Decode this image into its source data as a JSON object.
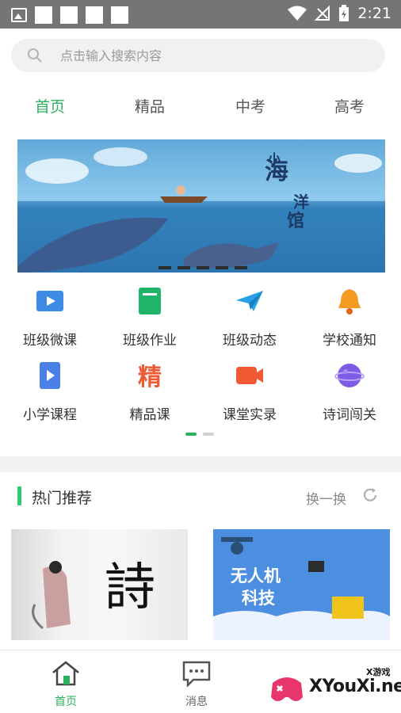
{
  "status_bar": {
    "time": "2:21"
  },
  "search": {
    "placeholder": "点击输入搜索内容"
  },
  "tabs": [
    {
      "label": "首页",
      "active": true
    },
    {
      "label": "精品",
      "active": false
    },
    {
      "label": "中考",
      "active": false
    },
    {
      "label": "高考",
      "active": false
    }
  ],
  "banner": {
    "slides": 5,
    "current_slide": 1
  },
  "features": [
    {
      "label": "班级微课",
      "icon": "video-lesson-icon"
    },
    {
      "label": "班级作业",
      "icon": "homework-book-icon"
    },
    {
      "label": "班级动态",
      "icon": "paper-plane-icon"
    },
    {
      "label": "学校通知",
      "icon": "bell-icon"
    },
    {
      "label": "小学课程",
      "icon": "course-book-icon"
    },
    {
      "label": "精品课",
      "icon": "premium-course-icon"
    },
    {
      "label": "课堂实录",
      "icon": "video-camera-icon"
    },
    {
      "label": "诗词闯关",
      "icon": "planet-icon"
    }
  ],
  "features_pager": {
    "pages": 2,
    "current": 1
  },
  "hot": {
    "title": "热门推荐",
    "swap_label": "换一换",
    "cards": [
      {
        "text": "詩"
      },
      {
        "text": "无人机\n科技"
      }
    ]
  },
  "bottom_nav": [
    {
      "label": "首页",
      "icon": "home-icon",
      "active": true
    },
    {
      "label": "消息",
      "icon": "message-icon",
      "active": false
    }
  ],
  "watermark": {
    "text": "XYouXi.net",
    "small": "X游戏"
  },
  "colors": {
    "accent": "#2bb15c",
    "status_bar": "#757575"
  }
}
